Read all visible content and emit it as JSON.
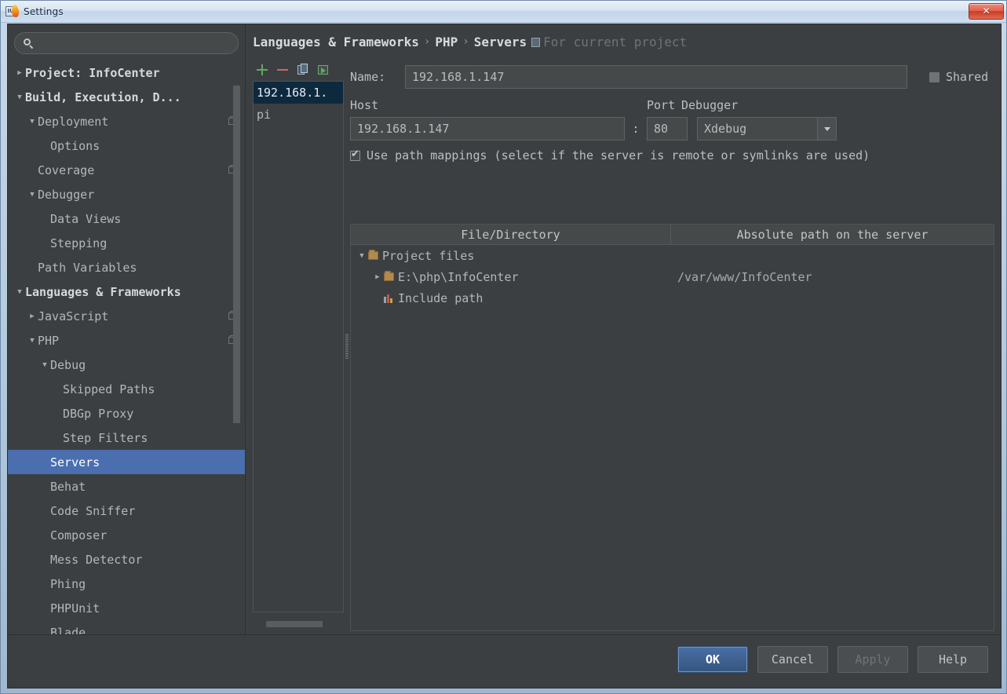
{
  "window": {
    "title": "Settings",
    "app_icon": "intellij-idea-icon",
    "close_label": "✕"
  },
  "sidebar": {
    "search": {
      "value": "",
      "placeholder": "",
      "icon": "search-icon"
    },
    "items": [
      {
        "label": "Project: InfoCenter",
        "arrow": "▶",
        "indent": 0,
        "bold": true,
        "selected": false,
        "badge": false
      },
      {
        "label": "Build, Execution, D...",
        "arrow": "▼",
        "indent": 0,
        "bold": true,
        "selected": false,
        "badge": false
      },
      {
        "label": "Deployment",
        "arrow": "▼",
        "indent": 1,
        "bold": false,
        "selected": false,
        "badge": true
      },
      {
        "label": "Options",
        "arrow": "",
        "indent": 2,
        "bold": false,
        "selected": false,
        "badge": false
      },
      {
        "label": "Coverage",
        "arrow": "",
        "indent": 1,
        "bold": false,
        "selected": false,
        "badge": true
      },
      {
        "label": "Debugger",
        "arrow": "▼",
        "indent": 1,
        "bold": false,
        "selected": false,
        "badge": false
      },
      {
        "label": "Data Views",
        "arrow": "",
        "indent": 2,
        "bold": false,
        "selected": false,
        "badge": false
      },
      {
        "label": "Stepping",
        "arrow": "",
        "indent": 2,
        "bold": false,
        "selected": false,
        "badge": false
      },
      {
        "label": "Path Variables",
        "arrow": "",
        "indent": 1,
        "bold": false,
        "selected": false,
        "badge": false
      },
      {
        "label": "Languages & Frameworks",
        "arrow": "▼",
        "indent": 0,
        "bold": true,
        "selected": false,
        "badge": false
      },
      {
        "label": "JavaScript",
        "arrow": "▶",
        "indent": 1,
        "bold": false,
        "selected": false,
        "badge": true
      },
      {
        "label": "PHP",
        "arrow": "▼",
        "indent": 1,
        "bold": false,
        "selected": false,
        "badge": true
      },
      {
        "label": "Debug",
        "arrow": "▼",
        "indent": 2,
        "bold": false,
        "selected": false,
        "badge": false
      },
      {
        "label": "Skipped Paths",
        "arrow": "",
        "indent": 3,
        "bold": false,
        "selected": false,
        "badge": false
      },
      {
        "label": "DBGp Proxy",
        "arrow": "",
        "indent": 3,
        "bold": false,
        "selected": false,
        "badge": false
      },
      {
        "label": "Step Filters",
        "arrow": "",
        "indent": 3,
        "bold": false,
        "selected": false,
        "badge": false
      },
      {
        "label": "Servers",
        "arrow": "",
        "indent": 2,
        "bold": false,
        "selected": true,
        "badge": false
      },
      {
        "label": "Behat",
        "arrow": "",
        "indent": 2,
        "bold": false,
        "selected": false,
        "badge": false
      },
      {
        "label": "Code Sniffer",
        "arrow": "",
        "indent": 2,
        "bold": false,
        "selected": false,
        "badge": false
      },
      {
        "label": "Composer",
        "arrow": "",
        "indent": 2,
        "bold": false,
        "selected": false,
        "badge": false
      },
      {
        "label": "Mess Detector",
        "arrow": "",
        "indent": 2,
        "bold": false,
        "selected": false,
        "badge": false
      },
      {
        "label": "Phing",
        "arrow": "",
        "indent": 2,
        "bold": false,
        "selected": false,
        "badge": false
      },
      {
        "label": "PHPUnit",
        "arrow": "",
        "indent": 2,
        "bold": false,
        "selected": false,
        "badge": false
      },
      {
        "label": "Blade",
        "arrow": "",
        "indent": 2,
        "bold": false,
        "selected": false,
        "badge": false
      }
    ]
  },
  "breadcrumb": {
    "part1": "Languages & Frameworks",
    "sep1": "›",
    "part2": "PHP",
    "sep2": "›",
    "part3": "Servers",
    "scope_icon": "project-scope-icon",
    "scope_text": "For current project"
  },
  "server_panel": {
    "toolbar": [
      {
        "name": "add-server-button",
        "label": "+"
      },
      {
        "name": "remove-server-button",
        "label": "−"
      },
      {
        "name": "copy-server-button",
        "label": "Copy"
      },
      {
        "name": "import-server-button",
        "label": "Import"
      }
    ],
    "servers": [
      {
        "label": "192.168.1.",
        "selected": true
      },
      {
        "label": "pi",
        "selected": false
      }
    ]
  },
  "form": {
    "name_label": "Name:",
    "name_value": "192.168.1.147",
    "shared_label": "Shared",
    "shared_checked": false,
    "host_label": "Host",
    "host_value": "192.168.1.147",
    "colon": ":",
    "port_label": "Port",
    "port_value": "80",
    "debugger_label": "Debugger",
    "debugger_value": "Xdebug",
    "path_mappings_label": "Use path mappings (select if the server is remote or symlinks are used)",
    "path_mappings_checked": true
  },
  "mappings": {
    "headers": [
      "File/Directory",
      "Absolute path on the server"
    ],
    "rows": [
      {
        "twisty": "▼",
        "icon": "folder-icon",
        "file": "Project files",
        "server_path": "",
        "indent": 0
      },
      {
        "twisty": "▶",
        "icon": "folder-icon",
        "file": "E:\\php\\InfoCenter",
        "server_path": "/var/www/InfoCenter",
        "indent": 1
      },
      {
        "twisty": "",
        "icon": "include-path-icon",
        "file": "Include path",
        "server_path": "",
        "indent": 1
      }
    ]
  },
  "footer": {
    "ok": "OK",
    "cancel": "Cancel",
    "apply": "Apply",
    "help": "Help"
  },
  "colors": {
    "background": "#3c3f41",
    "selection": "#4b6eaf",
    "list_selection": "#0d293e",
    "accent_add": "#62a862",
    "accent_remove": "#c96a5e",
    "primary_button": "#34557f"
  }
}
